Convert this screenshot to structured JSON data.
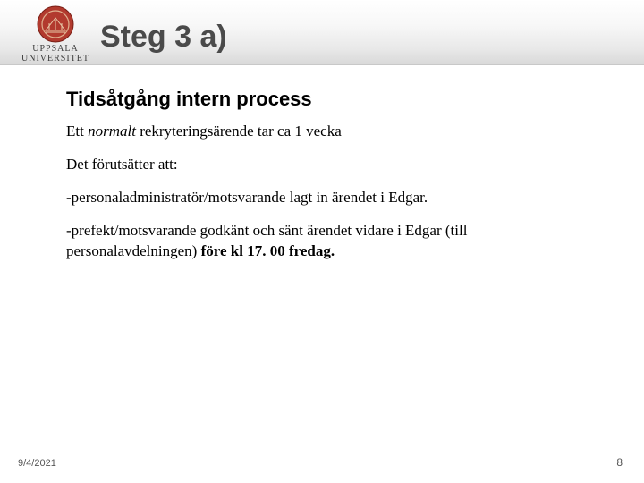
{
  "header": {
    "logo_top": "UPPSALA",
    "logo_bottom": "UNIVERSITET",
    "title": "Steg 3 a)"
  },
  "body": {
    "subheading": "Tidsåtgång intern process",
    "p1_pre": "Ett ",
    "p1_italic": "normalt",
    "p1_post": " rekryteringsärende tar ca 1 vecka",
    "p2": "Det förutsätter att:",
    "p3": "-personaladministratör/motsvarande lagt in ärendet i Edgar.",
    "p4_pre": "-prefekt/motsvarande godkänt och sänt ärendet vidare i Edgar (till personalavdelningen) ",
    "p4_bold": "före kl 17. 00 fredag."
  },
  "footer": {
    "date": "9/4/2021",
    "page": "8"
  }
}
